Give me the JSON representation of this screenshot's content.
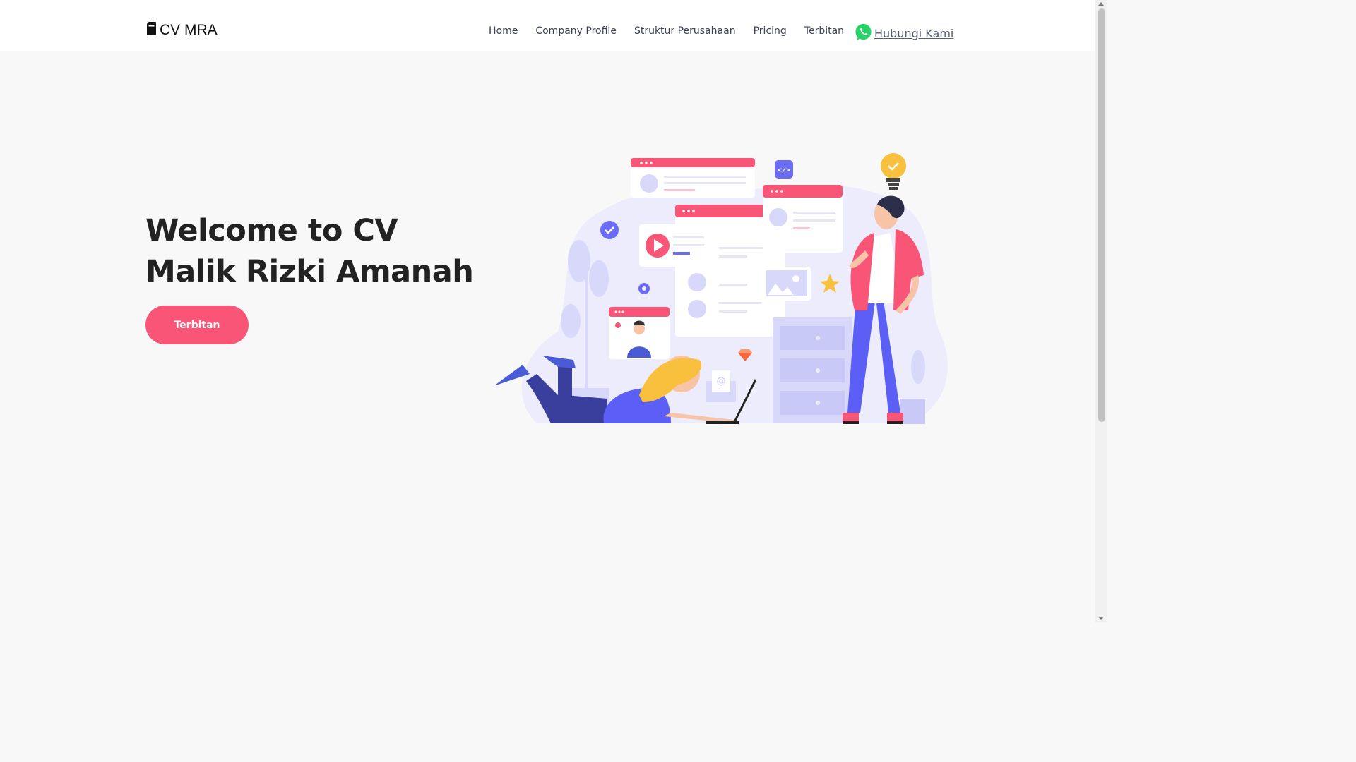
{
  "brand": {
    "name": "CV MRA",
    "icon": "book-icon"
  },
  "nav": {
    "items": [
      {
        "label": "Home"
      },
      {
        "label": "Company Profile"
      },
      {
        "label": "Struktur Perusahaan"
      },
      {
        "label": "Pricing"
      },
      {
        "label": "Terbitan"
      }
    ],
    "contact": {
      "label": "Hubungi Kami",
      "icon": "whatsapp-icon"
    }
  },
  "hero": {
    "title": "Welcome to CV Malik Rizki Amanah",
    "button": "Terbitan",
    "illustration": "people-working-illustration"
  },
  "colors": {
    "accent": "#f85577",
    "purple": "#6b6cf5",
    "yellow": "#f8c03c",
    "whatsapp": "#25d366"
  }
}
